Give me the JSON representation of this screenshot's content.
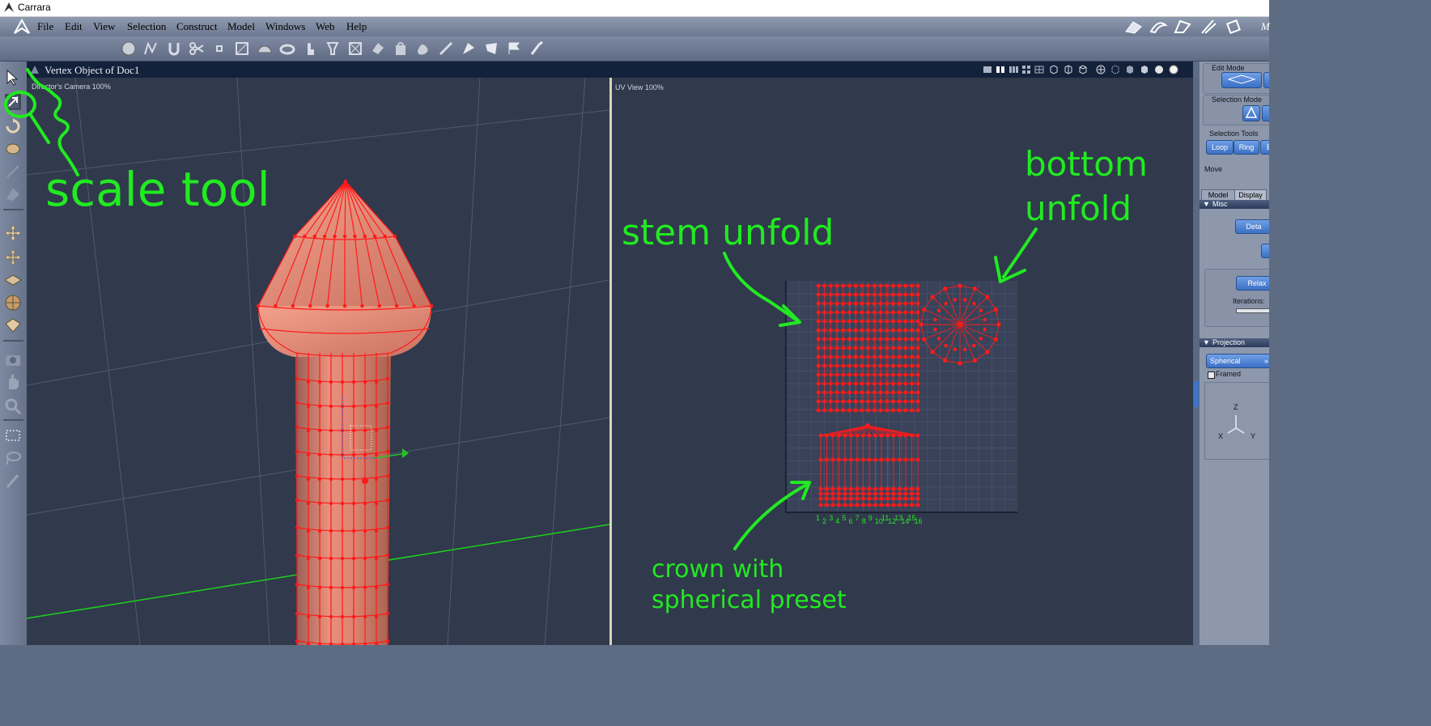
{
  "window": {
    "title": "Carrara"
  },
  "menu": {
    "items": [
      {
        "label": "File"
      },
      {
        "label": "Edit"
      },
      {
        "label": "View"
      },
      {
        "label": "Selection"
      },
      {
        "label": "Construct"
      },
      {
        "label": "Model"
      },
      {
        "label": "Windows"
      },
      {
        "label": "Web"
      },
      {
        "label": "Help"
      }
    ],
    "overflow_label": "M"
  },
  "document": {
    "title": "Vertex Object of Doc1"
  },
  "viewport3d": {
    "camera_label": "Director's Camera 100%"
  },
  "uvview": {
    "label": "UV View 100%",
    "column_numbers_top": [
      "1",
      "2",
      "3",
      "4",
      "5",
      "6",
      "7",
      "8",
      "9",
      "10",
      "11",
      "12",
      "13",
      "14",
      "15",
      "16"
    ]
  },
  "right_panel": {
    "edit_mode_label": "Edit Mode",
    "selection_mode_label": "Selection Mode",
    "selection_tools_label": "Selection Tools",
    "loop_button": "Loop",
    "ring_button": "Ring",
    "b_button": "B",
    "move_label": "Move",
    "tabs": [
      {
        "label": "Model"
      },
      {
        "label": "Display"
      }
    ],
    "misc_section": "Misc",
    "detach_button": "Deta",
    "relax_button": "Relax",
    "iterations_label": "Iterations:",
    "projection_section": "Projection",
    "projection_value": "Spherical",
    "framed_label": "Framed",
    "axis_z": "Z",
    "axis_x": "X",
    "axis_y": "Y"
  },
  "annotations": {
    "scale_tool": "scale tool",
    "stem_unfold": "stem unfold",
    "bottom_unfold_1": "bottom",
    "bottom_unfold_2": "unfold",
    "crown_1": "crown with",
    "crown_2": "spherical preset"
  },
  "colors": {
    "annotation_green": "#21ea21",
    "viewport_bg": "#31394c",
    "mesh_red": "#ff1a1a",
    "mesh_fill": "#e9907d"
  }
}
